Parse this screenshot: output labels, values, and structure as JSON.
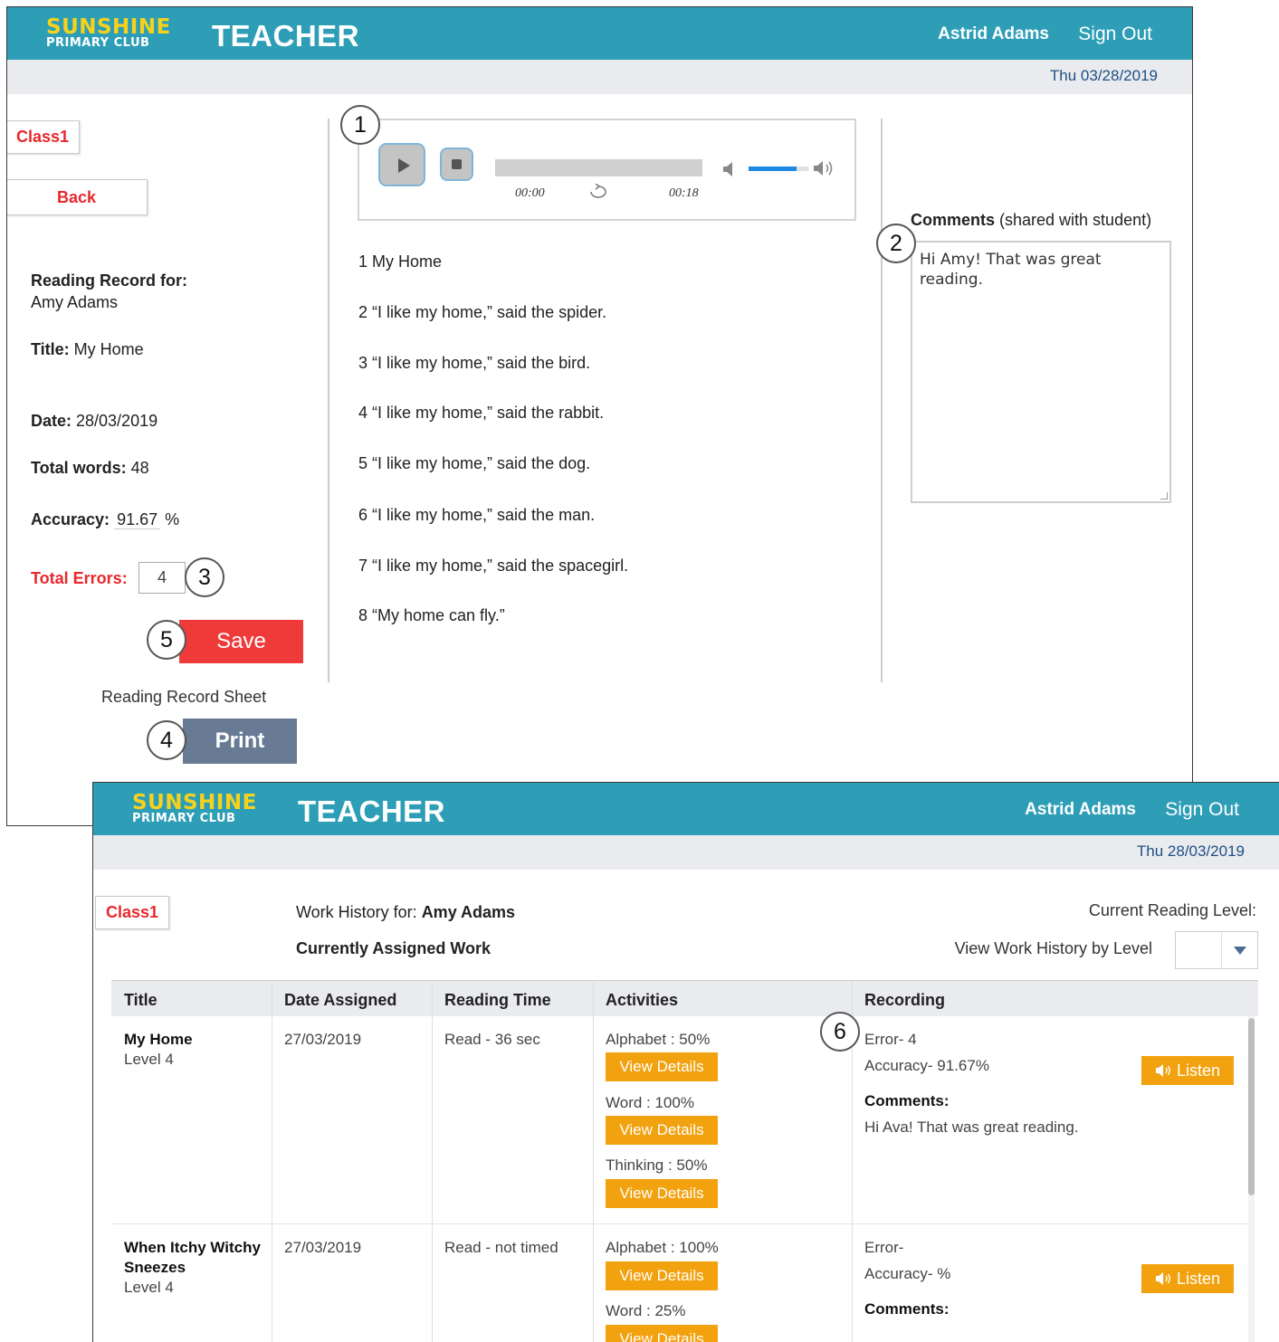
{
  "brand": {
    "line1": "SUNSHINE",
    "line2": "PRIMARY CLUB",
    "app_title": "TEACHER"
  },
  "record_screen": {
    "user_name": "Astrid Adams",
    "sign_out": "Sign Out",
    "date": "Thu 03/28/2019",
    "class_button": "Class1",
    "back_button": "Back",
    "reading_record_for_label": "Reading Record for:",
    "student_name": "Amy Adams",
    "title_label": "Title:",
    "title_value": " My Home",
    "date_label": "Date:",
    "date_value": " 28/03/2019",
    "total_words_label": "Total words:",
    "total_words_value": " 48",
    "accuracy_label": "Accuracy:",
    "accuracy_value": "91.67",
    "accuracy_unit": "%",
    "total_errors_label": "Total Errors:",
    "total_errors_value": "4",
    "save_button": "Save",
    "sheet_label": "Reading Record Sheet",
    "print_button": "Print",
    "player": {
      "current_time": "00:00",
      "duration": "00:18",
      "volume": 0.8,
      "progress": 0
    },
    "story_lines": [
      "1 My Home",
      "2 “I like my home,” said the spider.",
      "3 “I like my home,” said the bird.",
      "4 “I like my home,” said the rabbit.",
      "5 “I like my home,” said the dog.",
      "6 “I like my home,” said the man.",
      "7 “I like my home,” said the spacegirl.",
      "8 “My home can fly.”"
    ],
    "comments_label": "Comments",
    "comments_hint": " (shared with student)",
    "comments_text": "Hi Amy! That was great reading."
  },
  "history_screen": {
    "user_name": "Astrid Adams",
    "sign_out": "Sign Out",
    "date": "Thu 28/03/2019",
    "class_button": "Class1",
    "work_history_label": "Work History for: ",
    "student_name": "Amy Adams",
    "assigned_heading": "Currently Assigned Work",
    "current_level_label": "Current Reading Level:",
    "view_by_level_label": "View Work History by Level",
    "level_selected": "",
    "columns": [
      "Title",
      "Date Assigned",
      "Reading Time",
      "Activities",
      "Recording"
    ],
    "rows": [
      {
        "title": "My Home",
        "level": "Level 4",
        "date_assigned": "27/03/2019",
        "reading_time": "Read - 36 sec",
        "activities": [
          {
            "label": "Alphabet : 50%",
            "button": "View Details"
          },
          {
            "label": "Word : 100%",
            "button": "View Details"
          },
          {
            "label": "Thinking : 50%",
            "button": "View Details"
          }
        ],
        "error": "Error- 4",
        "accuracy": "Accuracy- 91.67%",
        "comments_label": "Comments:",
        "comments": "Hi Ava! That was great reading.",
        "listen": "Listen"
      },
      {
        "title": "When Itchy Witchy Sneezes",
        "level": "Level 4",
        "date_assigned": "27/03/2019",
        "reading_time": "Read - not timed",
        "activities": [
          {
            "label": "Alphabet : 100%",
            "button": "View Details"
          },
          {
            "label": "Word : 25%",
            "button": "View Details"
          }
        ],
        "error": "Error-",
        "accuracy": "Accuracy- %",
        "comments_label": "Comments:",
        "comments": "",
        "listen": "Listen"
      }
    ]
  },
  "callouts": [
    "1",
    "2",
    "3",
    "4",
    "5",
    "6"
  ],
  "colors": {
    "header": "#2e9eb7",
    "logo_yellow": "#f7d21c",
    "date_bar": "#e9ebee",
    "accent_red": "#ef3a3a",
    "print_slate": "#687a94",
    "orange": "#f2a20f",
    "date_blue": "#1f4f86"
  }
}
